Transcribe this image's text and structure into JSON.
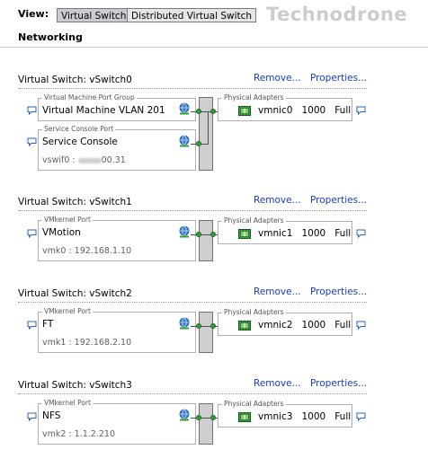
{
  "header": {
    "view_label": "View:",
    "view_buttons": [
      {
        "label": "Virtual Switch",
        "active": true
      },
      {
        "label": "Distributed Virtual Switch",
        "active": false
      }
    ],
    "watermark": "Technodrone",
    "section_title": "Networking"
  },
  "links": {
    "remove": "Remove...",
    "properties": "Properties..."
  },
  "icons": {
    "comment": "speech-bubble-icon",
    "port_group": "globe-network-icon",
    "nic": "network-card-icon"
  },
  "colors": {
    "link": "#1a3fb0",
    "connector": "#2e9f3a",
    "switch": "#cfcfcf"
  },
  "switches": [
    {
      "title": "Virtual Switch: vSwitch0",
      "groups": [
        {
          "caption": "Virtual Machine Port Group",
          "name": "Virtual Machine VLAN 201",
          "sub": ""
        },
        {
          "caption": "Service Console Port",
          "name": "Service Console",
          "sub_prefix": "vswif0 :",
          "sub_suffix": "00.31"
        }
      ],
      "adapter": {
        "caption": "Physical Adapters",
        "nic": "vmnic0",
        "speed": "1000",
        "duplex": "Full"
      }
    },
    {
      "title": "Virtual Switch: vSwitch1",
      "groups": [
        {
          "caption": "VMkernel Port",
          "name": "VMotion",
          "sub": "vmk0 : 192.168.1.10"
        }
      ],
      "adapter": {
        "caption": "Physical Adapters",
        "nic": "vmnic1",
        "speed": "1000",
        "duplex": "Full"
      }
    },
    {
      "title": "Virtual Switch: vSwitch2",
      "groups": [
        {
          "caption": "VMkernel Port",
          "name": "FT",
          "sub": "vmk1 : 192.168.2.10"
        }
      ],
      "adapter": {
        "caption": "Physical Adapters",
        "nic": "vmnic2",
        "speed": "1000",
        "duplex": "Full"
      }
    },
    {
      "title": "Virtual Switch: vSwitch3",
      "groups": [
        {
          "caption": "VMkernel Port",
          "name": "NFS",
          "sub": "vmk2 : 1.1.2.210"
        }
      ],
      "adapter": {
        "caption": "Physical Adapters",
        "nic": "vmnic3",
        "speed": "1000",
        "duplex": "Full"
      }
    }
  ]
}
